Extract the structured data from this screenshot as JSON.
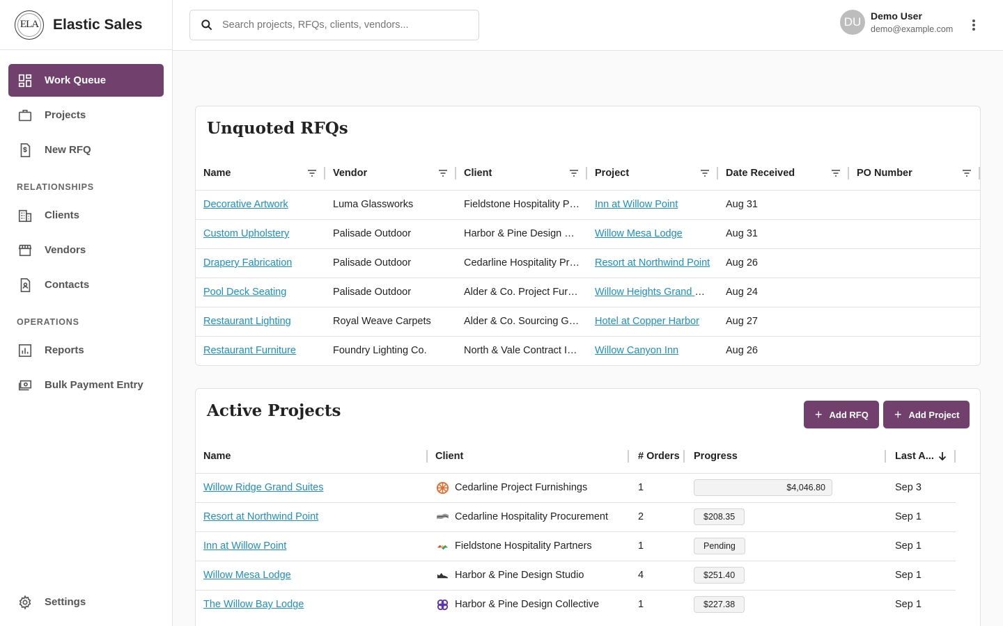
{
  "app": {
    "brand_name": "Elastic Sales",
    "logo_text": "ELA"
  },
  "sidebar": {
    "items": [
      {
        "label": "Work Queue",
        "icon": "dashboard-icon"
      },
      {
        "label": "Projects",
        "icon": "briefcase-icon"
      },
      {
        "label": "New RFQ",
        "icon": "invoice-dollar-icon"
      }
    ],
    "section_relationships": "RELATIONSHIPS",
    "relationships": [
      {
        "label": "Clients",
        "icon": "building-icon"
      },
      {
        "label": "Vendors",
        "icon": "storefront-icon"
      },
      {
        "label": "Contacts",
        "icon": "contact-file-icon"
      }
    ],
    "section_operations": "OPERATIONS",
    "operations": [
      {
        "label": "Reports",
        "icon": "bar-chart-icon"
      },
      {
        "label": "Bulk Payment Entry",
        "icon": "payments-icon"
      }
    ],
    "settings_label": "Settings"
  },
  "header": {
    "search_placeholder": "Search projects, RFQs, clients, vendors...",
    "user_initials": "DU",
    "user_name": "Demo User",
    "user_email": "demo@example.com"
  },
  "colors": {
    "accent": "#72406d",
    "link": "#1b8fc7"
  },
  "rfqs": {
    "title": "Unquoted RFQs",
    "columns": [
      "Name",
      "Vendor",
      "Client",
      "Project",
      "Date Received",
      "PO Number"
    ],
    "rows": [
      {
        "name": "Decorative Artwork",
        "vendor": "Luma Glassworks",
        "client": "Fieldstone Hospitality Pa...",
        "project": "Inn at Willow Point",
        "date": "Aug 31",
        "po": ""
      },
      {
        "name": "Custom Upholstery",
        "vendor": "Palisade Outdoor",
        "client": "Harbor & Pine Design Stu...",
        "project": "Willow Mesa Lodge",
        "date": "Aug 31",
        "po": ""
      },
      {
        "name": "Drapery Fabrication",
        "vendor": "Palisade Outdoor",
        "client": "Cedarline Hospitality Pro...",
        "project": "Resort at Northwind Point",
        "date": "Aug 26",
        "po": ""
      },
      {
        "name": "Pool Deck Seating",
        "vendor": "Palisade Outdoor",
        "client": "Alder & Co. Project Furni...",
        "project": "Willow Heights Grand Ho...",
        "date": "Aug 24",
        "po": ""
      },
      {
        "name": "Restaurant Lighting",
        "vendor": "Royal Weave Carpets",
        "client": "Alder & Co. Sourcing Gro...",
        "project": "Hotel at Copper Harbor",
        "date": "Aug 27",
        "po": ""
      },
      {
        "name": "Restaurant Furniture",
        "vendor": "Foundry Lighting Co.",
        "client": "North & Vale Contract Int...",
        "project": "Willow Canyon Inn",
        "date": "Aug 26",
        "po": ""
      }
    ]
  },
  "projects": {
    "title": "Active Projects",
    "add_rfq_label": "Add RFQ",
    "add_project_label": "Add Project",
    "columns": [
      "Name",
      "Client",
      "# Orders",
      "Progress",
      "Last A..."
    ],
    "rows": [
      {
        "name": "Willow Ridge Grand Suites",
        "client": "Cedarline Project Furnishings",
        "client_icon": "orange-flower-icon",
        "orders": "1",
        "progress": "$4,046.80",
        "progress_fraction": 1.0,
        "last": "Sep 3"
      },
      {
        "name": "Resort at Northwind Point",
        "client": "Cedarline Hospitality Procurement",
        "client_icon": "gray-wave-icon",
        "orders": "2",
        "progress": "$208.35",
        "progress_fraction": 0.05,
        "last": "Sep 1"
      },
      {
        "name": "Inn at Willow Point",
        "client": "Fieldstone Hospitality Partners",
        "client_icon": "rainbow-icon",
        "orders": "1",
        "progress": "Pending",
        "progress_fraction": 0.0,
        "last": "Sep 1"
      },
      {
        "name": "Willow Mesa Lodge",
        "client": "Harbor & Pine Design Studio",
        "client_icon": "dark-shoe-icon",
        "orders": "4",
        "progress": "$251.40",
        "progress_fraction": 0.06,
        "last": "Sep 1"
      },
      {
        "name": "The Willow Bay Lodge",
        "client": "Harbor & Pine Design Collective",
        "client_icon": "purple-knot-icon",
        "orders": "1",
        "progress": "$227.38",
        "progress_fraction": 0.05,
        "last": "Sep 1"
      }
    ]
  }
}
